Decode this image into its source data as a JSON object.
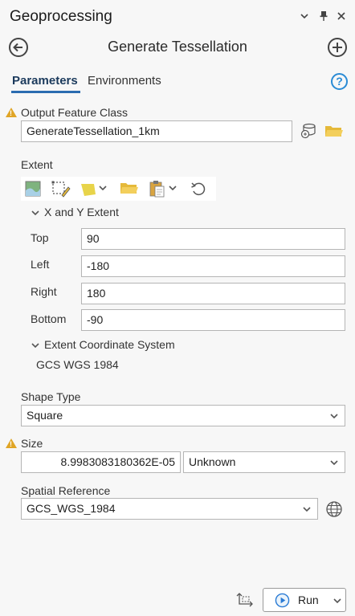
{
  "pane": {
    "title": "Geoprocessing",
    "controls": {
      "dropdown_glyph": "⌄",
      "pin_glyph": "📌",
      "close_glyph": "✕"
    }
  },
  "tool": {
    "name": "Generate Tessellation"
  },
  "tabs": [
    {
      "label": "Parameters",
      "active": true
    },
    {
      "label": "Environments",
      "active": false
    }
  ],
  "help_glyph": "?",
  "output_feature_class": {
    "label": "Output Feature Class",
    "value": "GenerateTessellation_1km"
  },
  "extent": {
    "label": "Extent",
    "xy_section_label": "X and Y Extent",
    "fields": [
      {
        "label": "Top",
        "value": "90"
      },
      {
        "label": "Left",
        "value": "-180"
      },
      {
        "label": "Right",
        "value": "180"
      },
      {
        "label": "Bottom",
        "value": "-90"
      }
    ],
    "coord_section_label": "Extent Coordinate System",
    "coord_value": "GCS WGS 1984"
  },
  "shape_type": {
    "label": "Shape Type",
    "value": "Square"
  },
  "size": {
    "label": "Size",
    "value": "8.9983083180362E-05",
    "unit": "Unknown"
  },
  "spatial_reference": {
    "label": "Spatial Reference",
    "value": "GCS_WGS_1984"
  },
  "run": {
    "label": "Run"
  },
  "colors": {
    "warning": "#e0a526",
    "accent": "#2b6cb0",
    "help": "#2a8bd5",
    "folder": "#e5b93a"
  }
}
